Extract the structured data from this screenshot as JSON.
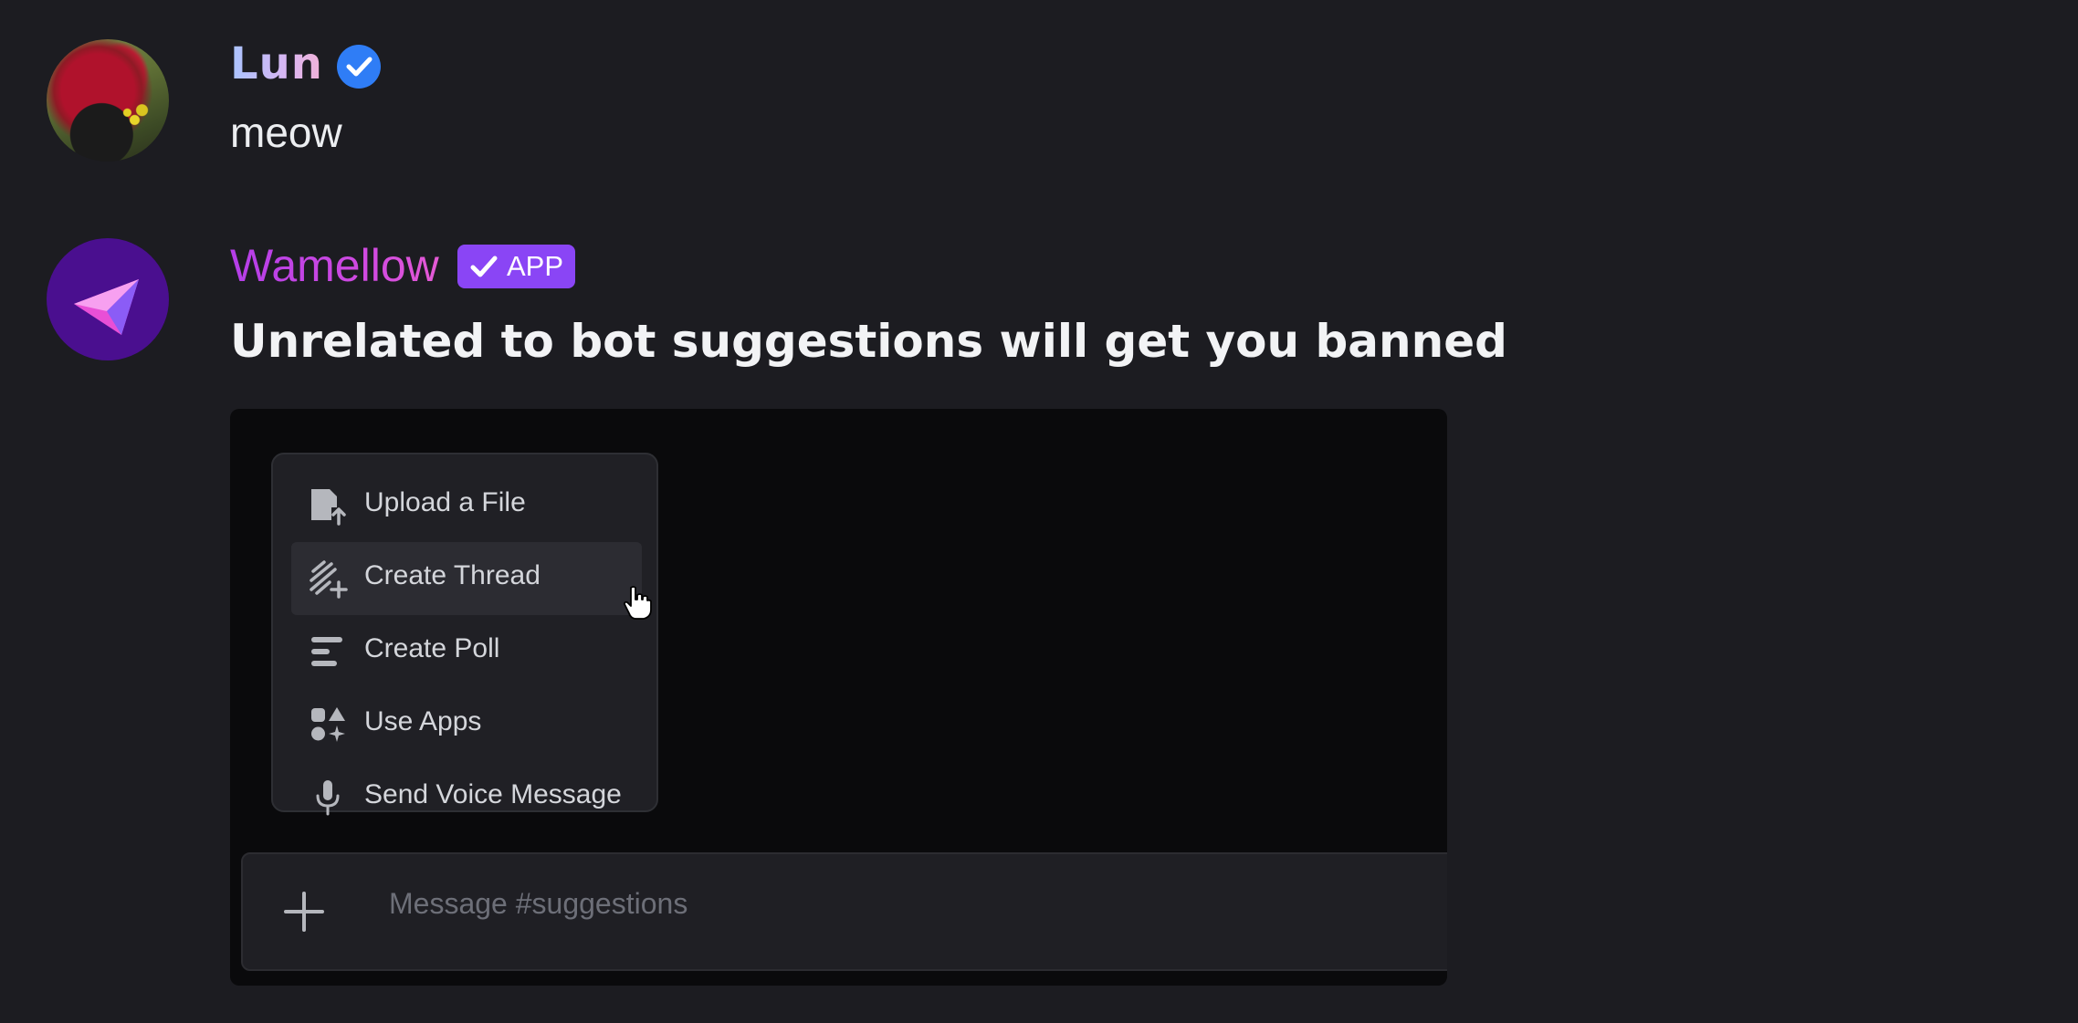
{
  "messages": [
    {
      "author": "Lun",
      "verified": true,
      "text": "meow"
    },
    {
      "author": "Wamellow",
      "tag": "APP",
      "text": "Unrelated to bot suggestions will get you banned",
      "attachment": {
        "menu": {
          "items": [
            {
              "label": "Upload a File",
              "icon": "upload-file-icon"
            },
            {
              "label": "Create Thread",
              "icon": "thread-icon",
              "hovered": true
            },
            {
              "label": "Create Poll",
              "icon": "poll-icon"
            },
            {
              "label": "Use Apps",
              "icon": "apps-icon"
            },
            {
              "label": "Send Voice Message",
              "icon": "microphone-icon"
            }
          ]
        },
        "composer": {
          "placeholder": "Message #suggestions"
        }
      }
    }
  ],
  "colors": {
    "background": "#1c1c21",
    "verified_badge": "#2f7df6",
    "app_tag": "#8a45f5",
    "wamellow_name": "#b43ee8"
  }
}
